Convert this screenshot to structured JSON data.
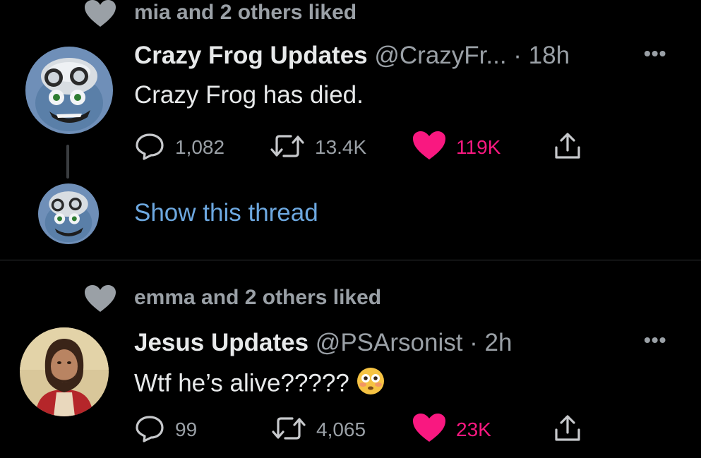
{
  "colors": {
    "background": "#000000",
    "text": "#e7e9ea",
    "muted": "#9aa0a6",
    "like_pink": "#f91880",
    "link_blue": "#6da8e0"
  },
  "tweets": [
    {
      "social_context": "mia and 2 others liked",
      "display_name": "Crazy Frog Updates",
      "handle_time": "@CrazyFr... · 18h",
      "text": "Crazy Frog has died.",
      "replies": "1,082",
      "retweets": "13.4K",
      "likes": "119K",
      "liked": true,
      "show_thread": "Show this thread",
      "avatar": "crazy-frog-avatar"
    },
    {
      "social_context": "emma and 2 others liked",
      "display_name": "Jesus Updates",
      "handle_time": "@PSArsonist · 2h",
      "text": "Wtf he’s alive?????",
      "emoji": "flushed-face-emoji",
      "replies": "99",
      "retweets": "4,065",
      "likes": "23K",
      "liked": true,
      "avatar": "jesus-portrait-avatar"
    }
  ],
  "icons": {
    "social_heart": "heart-icon",
    "reply": "reply-icon",
    "retweet": "retweet-icon",
    "like": "heart-icon",
    "share": "share-icon",
    "more": "more-icon"
  }
}
